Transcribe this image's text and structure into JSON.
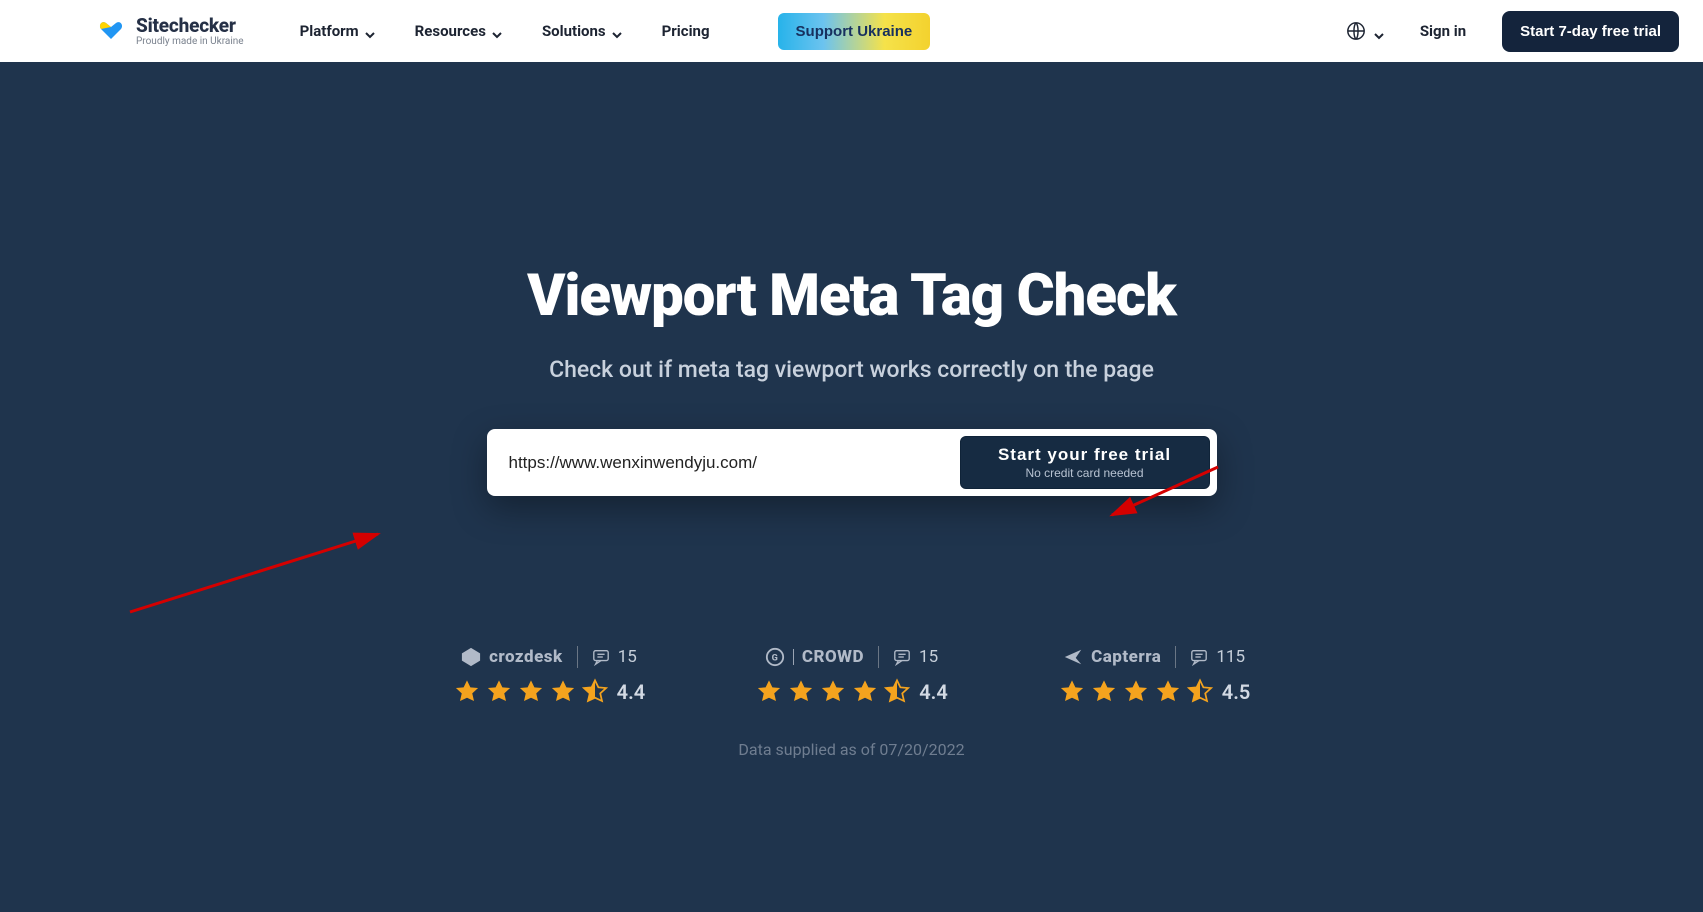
{
  "header": {
    "brand_name": "Sitechecker",
    "brand_tagline": "Proudly made in Ukraine",
    "nav": {
      "platform": "Platform",
      "resources": "Resources",
      "solutions": "Solutions",
      "pricing": "Pricing"
    },
    "support_button": "Support Ukraine",
    "signin": "Sign in",
    "cta": "Start 7-day free trial"
  },
  "hero": {
    "title": "Viewport Meta Tag Check",
    "subtitle": "Check out if meta tag viewport works correctly on the page",
    "input_value": "https://www.wenxinwendyju.com/",
    "trial_line1": "Start your free trial",
    "trial_line2": "No credit card needed"
  },
  "ratings": {
    "items": [
      {
        "provider": "crozdesk",
        "reviews": "15",
        "score": "4.4"
      },
      {
        "provider": "CROWD",
        "reviews": "15",
        "score": "4.4"
      },
      {
        "provider": "Capterra",
        "reviews": "115",
        "score": "4.5"
      }
    ],
    "as_of": "Data supplied as of 07/20/2022"
  }
}
